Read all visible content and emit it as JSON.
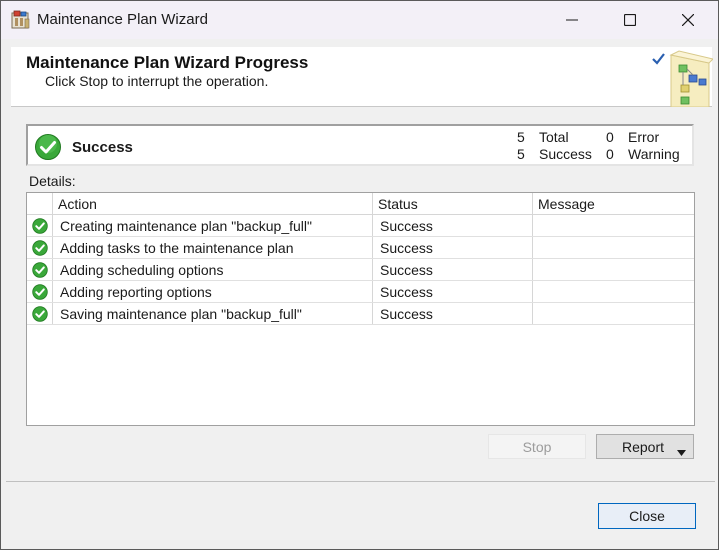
{
  "window": {
    "title": "Maintenance Plan Wizard"
  },
  "header": {
    "title": "Maintenance Plan Wizard Progress",
    "subtitle": "Click Stop to interrupt the operation."
  },
  "summary": {
    "status": "Success",
    "total_count": "5",
    "total_label": "Total",
    "success_count": "5",
    "success_label": "Success",
    "error_count": "0",
    "error_label": "Error",
    "warning_count": "0",
    "warning_label": "Warning"
  },
  "details": {
    "label": "Details:",
    "columns": [
      "Action",
      "Status",
      "Message"
    ],
    "rows": [
      {
        "action": "Creating maintenance plan \"backup_full\"",
        "status": "Success",
        "message": ""
      },
      {
        "action": "Adding tasks to the maintenance plan",
        "status": "Success",
        "message": ""
      },
      {
        "action": "Adding scheduling options",
        "status": "Success",
        "message": ""
      },
      {
        "action": "Adding reporting options",
        "status": "Success",
        "message": ""
      },
      {
        "action": "Saving maintenance plan \"backup_full\"",
        "status": "Success",
        "message": ""
      }
    ]
  },
  "buttons": {
    "stop": "Stop",
    "report": "Report",
    "close": "Close"
  },
  "colors": {
    "success_green": "#3aa83a",
    "accent_blue": "#0067c0"
  }
}
